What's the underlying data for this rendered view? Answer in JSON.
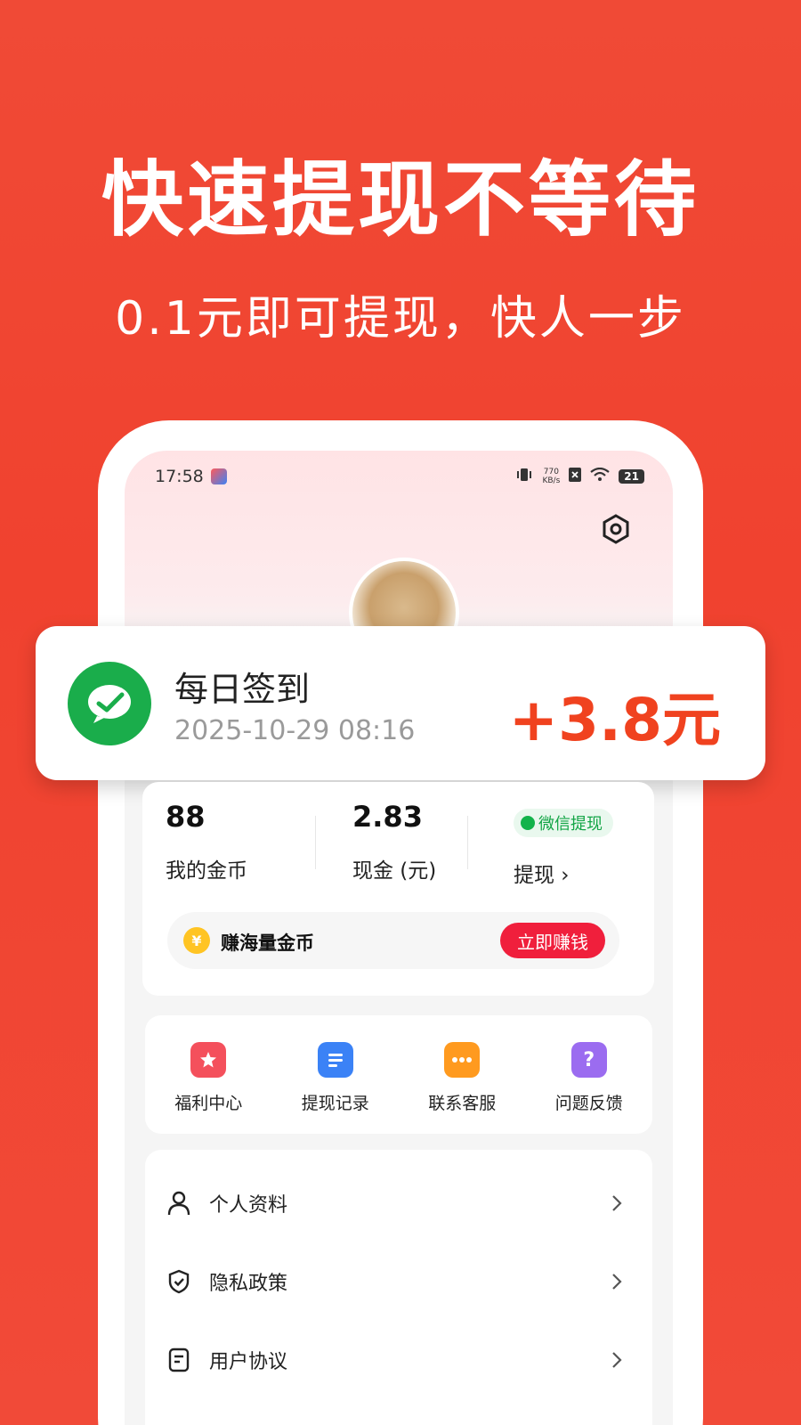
{
  "promo": {
    "headline": "快速提现不等待",
    "subline": "0.1元即可提现，快人一步"
  },
  "statusbar": {
    "time": "17:58",
    "net_speed_value": "770",
    "net_speed_unit": "KB/s",
    "battery": "21"
  },
  "notification": {
    "icon": "wechat-icon",
    "title": "每日签到",
    "time": "2025-10-29 08:16",
    "amount": "+3.8元"
  },
  "wallet": {
    "coins_value": "88",
    "coins_label": "我的金币",
    "cash_value": "2.83",
    "cash_label": "现金 (元)",
    "wechat_chip": "微信提现",
    "withdraw_label": "提现 ›",
    "earn_label": "赚海量金币",
    "earn_button": "立即赚钱",
    "coin_symbol": "¥"
  },
  "actions": [
    {
      "label": "福利中心",
      "icon": "gift-icon",
      "color": "#f4505c"
    },
    {
      "label": "提现记录",
      "icon": "list-icon",
      "color": "#3b82f6"
    },
    {
      "label": "联系客服",
      "icon": "chat-icon",
      "color": "#ff9a1f"
    },
    {
      "label": "问题反馈",
      "icon": "question-icon",
      "color": "#9b6cf0"
    }
  ],
  "menu": [
    {
      "label": "个人资料",
      "icon": "person-icon"
    },
    {
      "label": "隐私政策",
      "icon": "shield-icon"
    },
    {
      "label": "用户协议",
      "icon": "document-icon"
    }
  ],
  "colors": {
    "brand_red": "#f0422f",
    "amount_orange": "#f0421f",
    "wechat_green": "#1aad4b",
    "earn_button_red": "#f01f3c"
  }
}
